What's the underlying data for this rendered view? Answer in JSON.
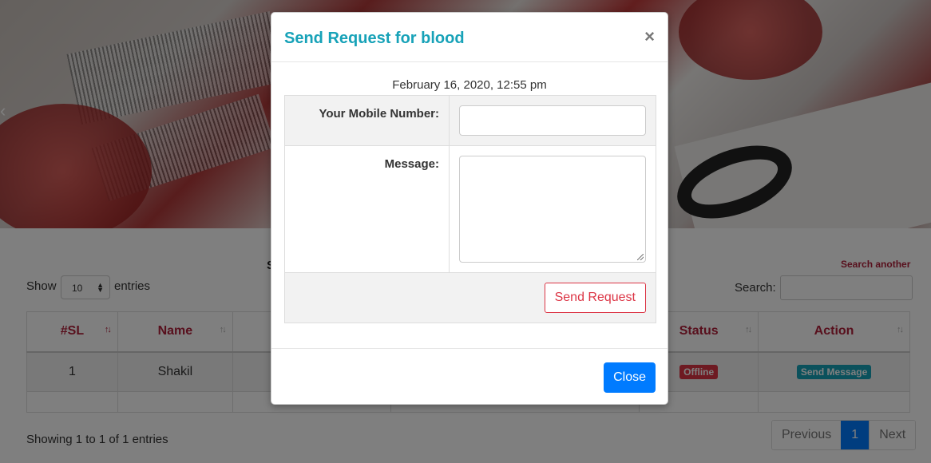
{
  "page": {
    "search_another": "Search another",
    "truncated_heading": "S",
    "show_label": "Show",
    "show_value": "10",
    "entries_label": "entries",
    "search_label": "Search:",
    "search_value": ""
  },
  "table": {
    "columns": [
      {
        "label": "#SL"
      },
      {
        "label": "Name"
      },
      {
        "label": ""
      },
      {
        "label": ""
      },
      {
        "label": "Status"
      },
      {
        "label": "Action"
      }
    ],
    "rows": [
      {
        "sl": "1",
        "name": "Shakil",
        "col3": "",
        "col4": "",
        "status": "Offline",
        "action": "Send Message"
      }
    ]
  },
  "footer": {
    "showing": "Showing 1 to 1 of 1 entries",
    "previous": "Previous",
    "current_page": "1",
    "next": "Next"
  },
  "modal": {
    "title": "Send Request for blood",
    "close_symbol": "×",
    "date": "February 16, 2020, 12:55 pm",
    "mobile_label": "Your Mobile Number:",
    "mobile_value": "",
    "message_label": "Message:",
    "message_value": "",
    "send_button": "Send Request",
    "close_button": "Close"
  },
  "colors": {
    "title": "#17a2b8",
    "header_text": "#b0203a",
    "primary": "#007bff",
    "danger": "#dc3545",
    "info": "#17a2b8"
  },
  "icons": {
    "carousel_prev": "chevron-left-icon",
    "sort": "sort-arrows-icon",
    "select_caret": "caret-updown-icon",
    "modal_close": "close-icon"
  }
}
